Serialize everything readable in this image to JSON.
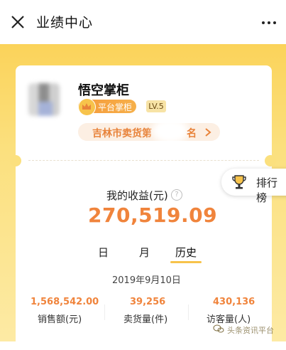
{
  "header": {
    "title": "业绩中心",
    "close_icon": "close-icon",
    "more_icon": "more-icon"
  },
  "profile": {
    "name": "悟空掌柜",
    "badge": "平台掌柜",
    "level": "LV.5",
    "rank_prefix": "吉林市卖货第",
    "rank_suffix": "名"
  },
  "ranking": {
    "label": "排行榜",
    "icon": "trophy-icon"
  },
  "earnings": {
    "label": "我的收益(元)",
    "help": "?",
    "value": "270,519.09"
  },
  "tabs": [
    {
      "label": "日",
      "active": false
    },
    {
      "label": "月",
      "active": false
    },
    {
      "label": "历史",
      "active": true
    }
  ],
  "date": "2019年9月10日",
  "stats": [
    {
      "value": "1,568,542.00",
      "label": "销售额(元)"
    },
    {
      "value": "39,256",
      "label": "卖货量(件)"
    },
    {
      "value": "430,136",
      "label": "访客量(人)"
    }
  ],
  "watermark": "头条资讯平台",
  "colors": {
    "accent": "#f0843c",
    "yellow": "#fbd35a",
    "badge": "#f59a3a"
  }
}
